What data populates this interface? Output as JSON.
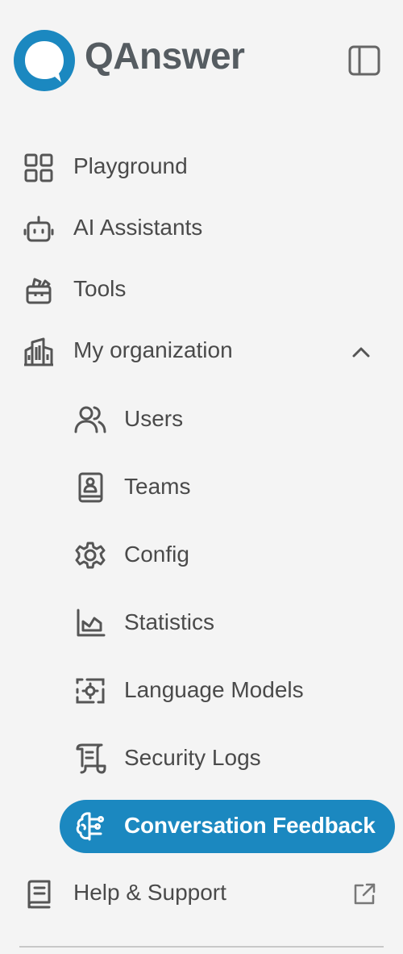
{
  "brand": {
    "name": "QAnswer",
    "accent_color": "#1b88c0"
  },
  "header": {
    "toggle_icon": "sidebar-toggle-icon"
  },
  "nav": {
    "items": [
      {
        "label": "Playground",
        "icon": "grid-icon"
      },
      {
        "label": "AI Assistants",
        "icon": "robot-icon"
      },
      {
        "label": "Tools",
        "icon": "toolbox-icon"
      },
      {
        "label": "My organization",
        "icon": "building-icon",
        "expanded": true
      }
    ],
    "org_children": [
      {
        "label": "Users",
        "icon": "users-icon"
      },
      {
        "label": "Teams",
        "icon": "contact-book-icon"
      },
      {
        "label": "Config",
        "icon": "gear-icon"
      },
      {
        "label": "Statistics",
        "icon": "chart-icon"
      },
      {
        "label": "Language Models",
        "icon": "model-chip-icon"
      },
      {
        "label": "Security Logs",
        "icon": "scroll-icon"
      },
      {
        "label": "Conversation Feedback",
        "icon": "brain-icon",
        "active": true
      }
    ],
    "help": {
      "label": "Help & Support",
      "icon": "book-icon",
      "external": true
    }
  }
}
